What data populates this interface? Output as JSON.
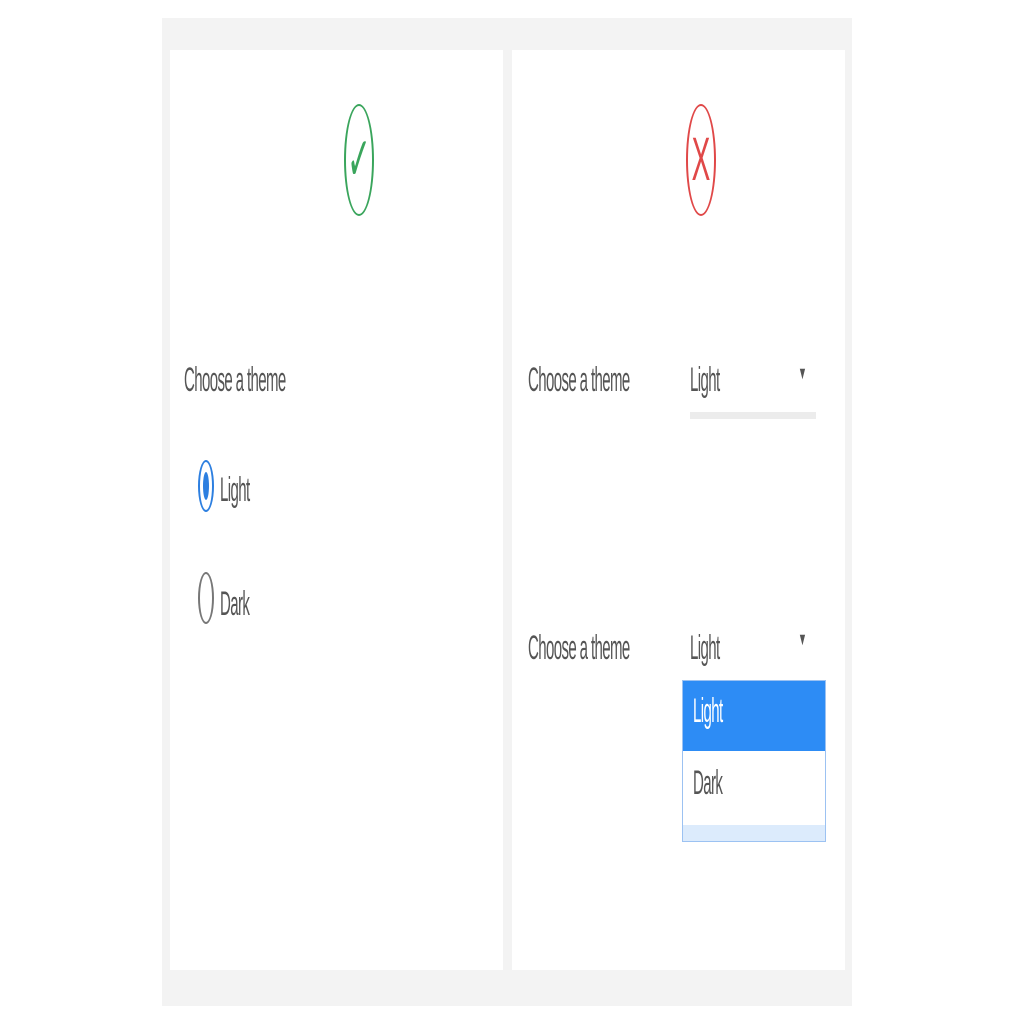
{
  "good_example": {
    "badge_icon": "check-icon",
    "badge_glyph": "✓",
    "radio_group": {
      "label": "Choose a theme",
      "options": [
        {
          "label": "Light",
          "checked": true
        },
        {
          "label": "Dark",
          "checked": false
        }
      ]
    }
  },
  "bad_example": {
    "badge_icon": "x-icon",
    "badge_glyph": "X",
    "select_closed": {
      "label": "Choose a theme",
      "value": "Light",
      "caret": "▼"
    },
    "select_open": {
      "label": "Choose a theme",
      "value": "Light",
      "caret": "▼",
      "options": [
        {
          "label": "Light",
          "selected": true
        },
        {
          "label": "Dark",
          "selected": false
        }
      ]
    }
  },
  "colors": {
    "good": "#3aa55c",
    "bad": "#e04848",
    "accent": "#2d8cf5"
  }
}
